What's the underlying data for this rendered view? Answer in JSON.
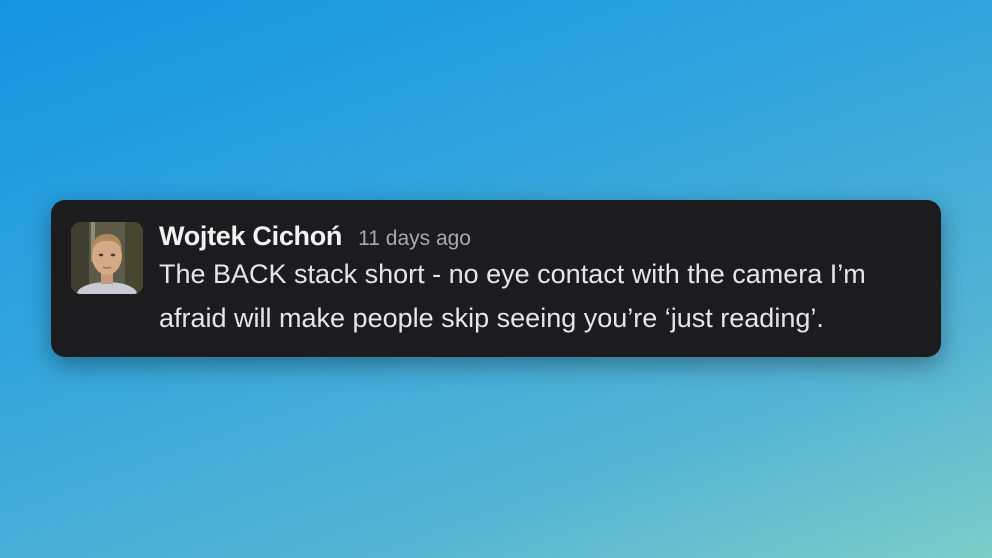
{
  "message": {
    "author": "Wojtek Cichoń",
    "timestamp": "11 days ago",
    "line1": "The BACK stack short - no eye contact with the camera I’m",
    "line2": "afraid will make people skip seeing you’re ‘just reading’."
  },
  "colors": {
    "card_background": "#1c1c1f",
    "author_text": "#f2f2f2",
    "timestamp_text": "#a9a9ad",
    "body_text": "#e6e6e8"
  },
  "icons": {
    "avatar": "user-avatar-photo"
  }
}
